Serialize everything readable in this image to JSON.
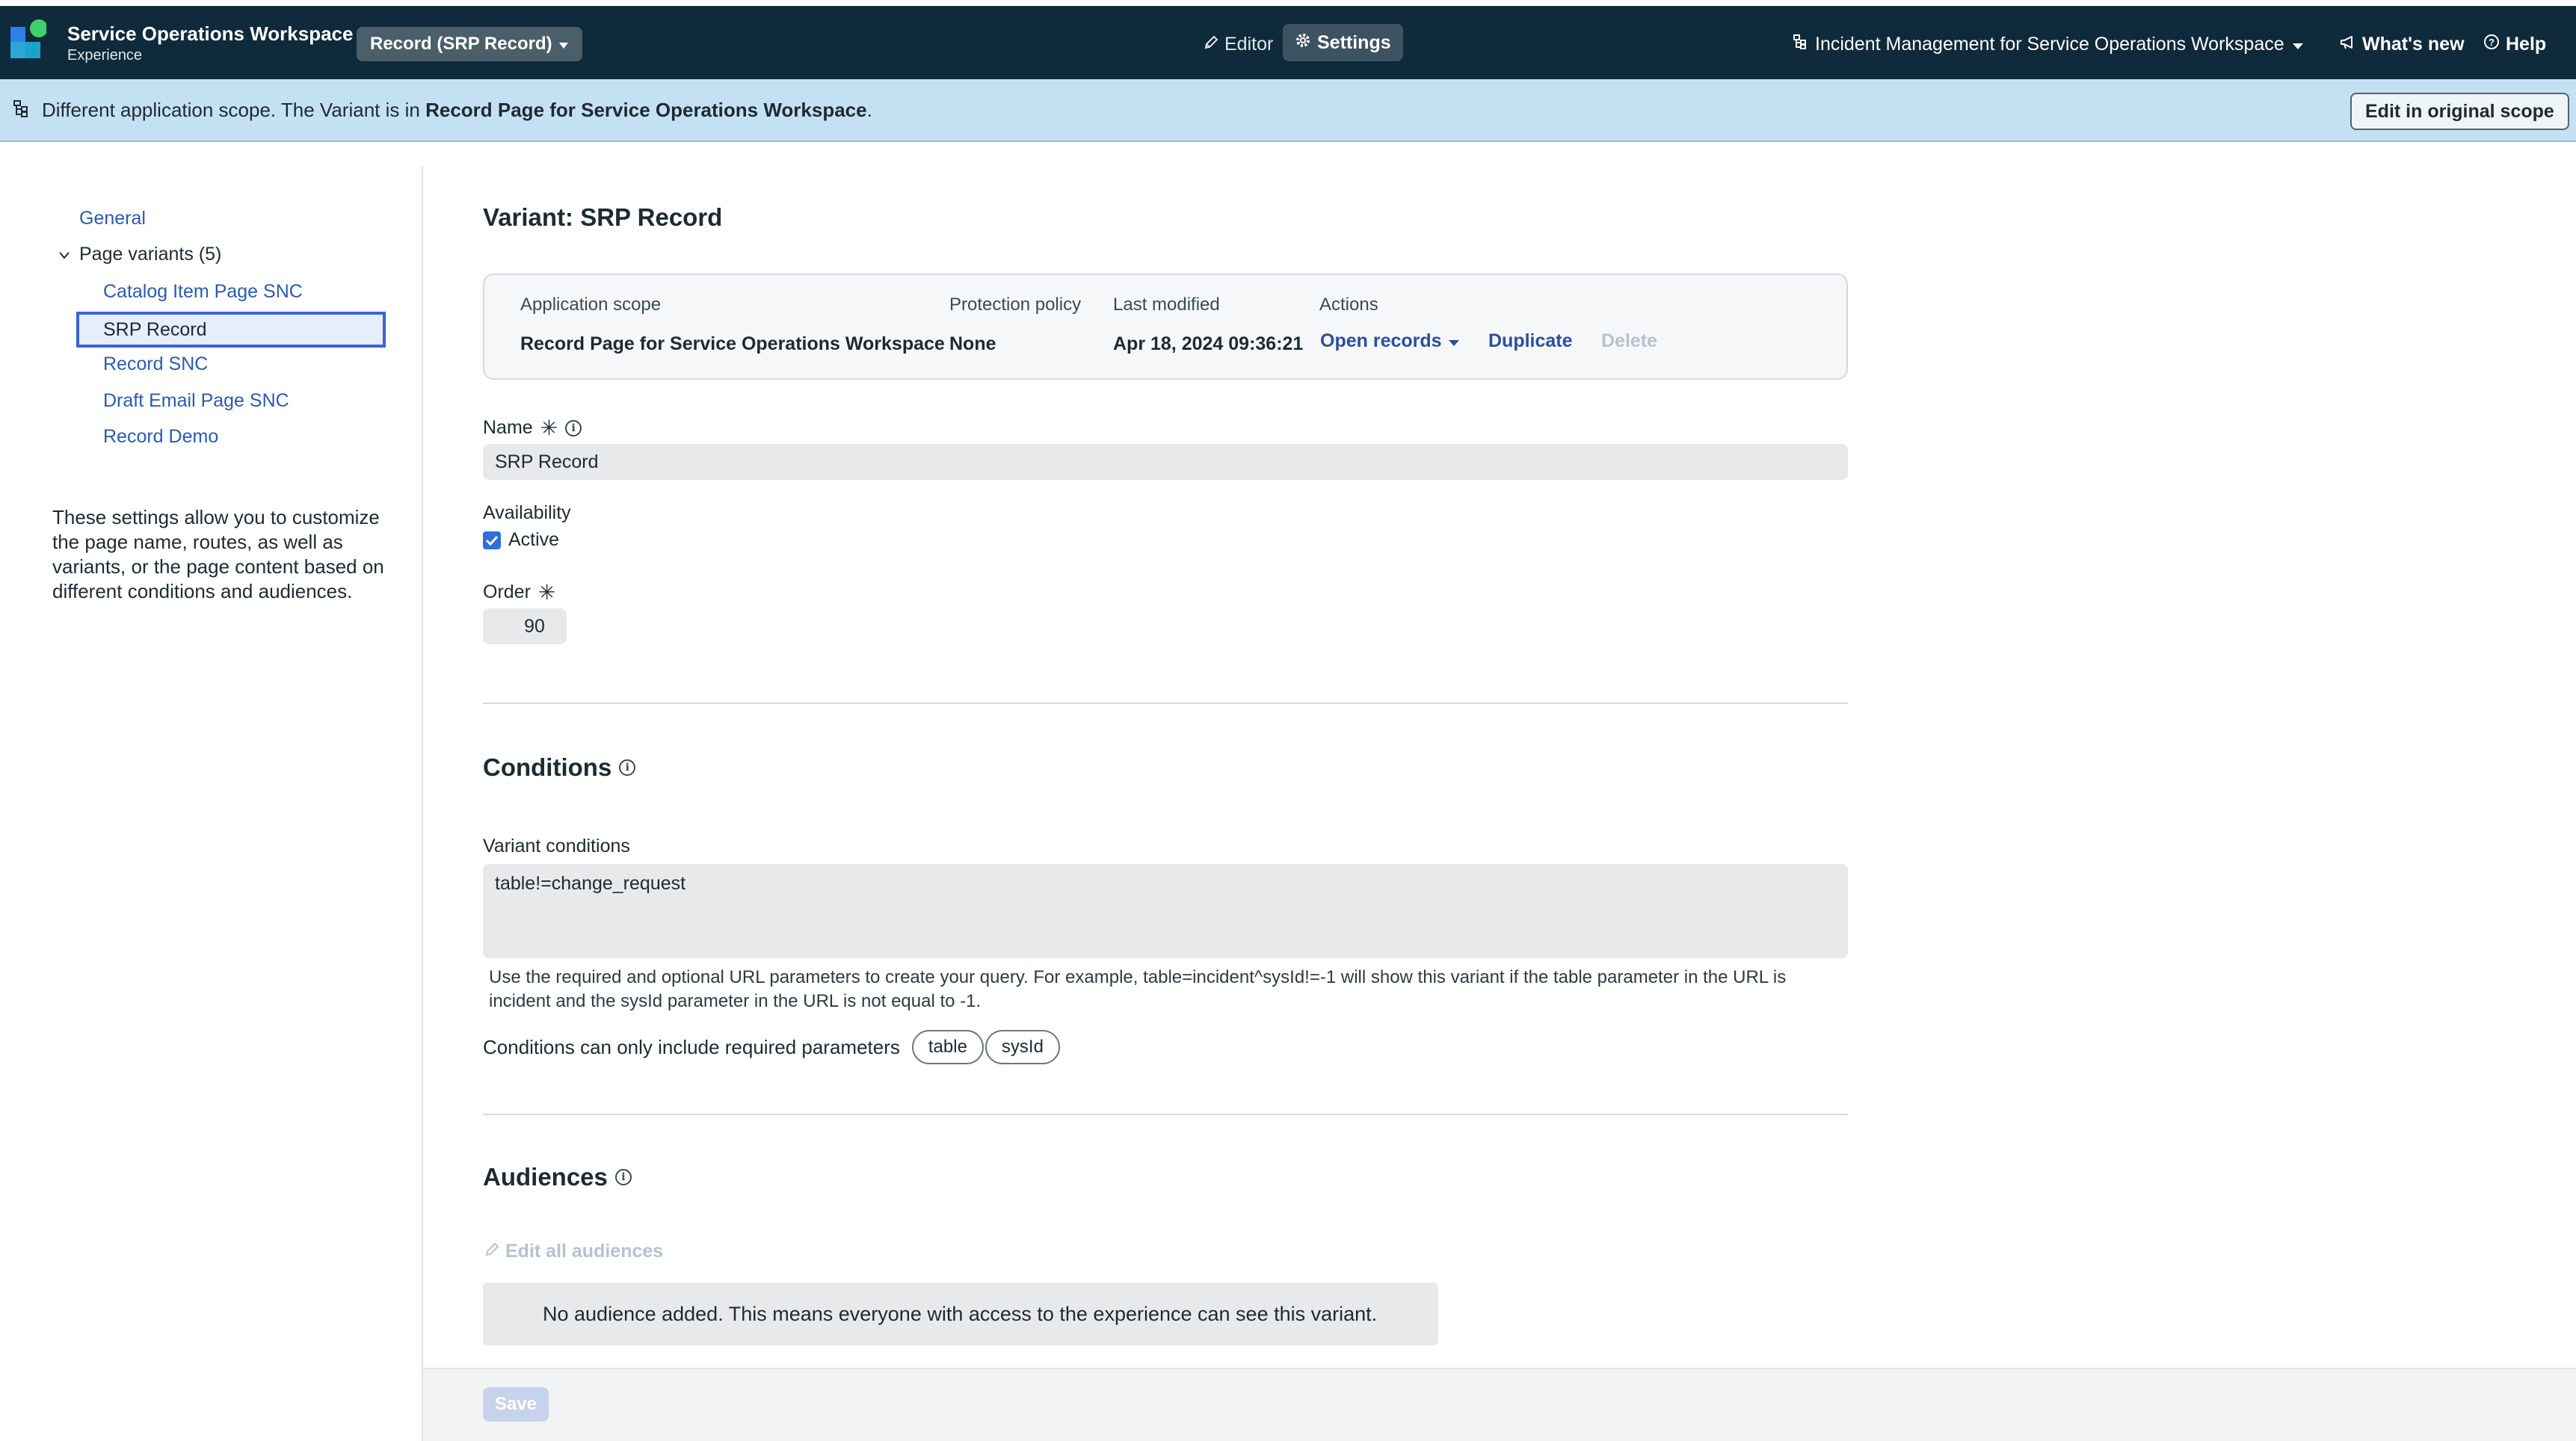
{
  "header": {
    "app_title": "Service Operations Workspace",
    "app_subtitle": "Experience",
    "page_select": "Record (SRP Record)",
    "tabs": {
      "editor": "Editor",
      "settings": "Settings"
    },
    "scope": "Incident Management for Service Operations Workspace",
    "whats_new": "What's new",
    "help": "Help"
  },
  "banner": {
    "text_prefix": "Different application scope. The Variant is in ",
    "scope_name": "Record Page for Service Operations Workspace",
    "text_suffix": ".",
    "button": "Edit in original scope"
  },
  "nav": {
    "general": "General",
    "variants_header": "Page variants (5)",
    "items": [
      {
        "label": "Catalog Item Page SNC"
      },
      {
        "label": "SRP Record",
        "selected": true
      },
      {
        "label": "Record SNC"
      },
      {
        "label": "Draft Email Page SNC"
      },
      {
        "label": "Record Demo"
      }
    ],
    "help_text": "These settings allow you to customize the page name, routes, as well as variants, or the page content based on different conditions and audiences."
  },
  "variant": {
    "title": "Variant: SRP Record",
    "card": {
      "scope_header": "Application scope",
      "scope_value": "Record Page for Service Operations Workspace",
      "policy_header": "Protection policy",
      "policy_value": "None",
      "modified_header": "Last modified",
      "modified_value": "Apr 18, 2024 09:36:21",
      "actions_header": "Actions",
      "open_records": "Open records",
      "duplicate": "Duplicate",
      "delete": "Delete"
    },
    "name_label": "Name",
    "name_value": "SRP Record",
    "availability_label": "Availability",
    "active_label": "Active",
    "active_checked": true,
    "order_label": "Order",
    "order_value": "90"
  },
  "conditions": {
    "title": "Conditions",
    "variant_conditions_label": "Variant conditions",
    "variant_conditions_value": "table!=change_request",
    "help": "Use the required and optional URL parameters to create your query. For example, table=incident^sysId!=-1 will show this variant if the table parameter in the URL is incident and the sysId parameter in the URL is not equal to -1.",
    "required_text": "Conditions can only include required parameters",
    "params": [
      "table",
      "sysId"
    ]
  },
  "audiences": {
    "title": "Audiences",
    "edit_all": "Edit all audiences",
    "empty_message": "No audience added. This means everyone with access to the experience can see this variant."
  },
  "footer": {
    "save": "Save"
  },
  "colors": {
    "topbar": "#0f2a3a",
    "banner": "#c4e1f4",
    "link": "#2c5ab0",
    "selected_border": "#3b62d9",
    "checkbox": "#2f6fda",
    "disabled": "#b6c2d2"
  },
  "icons": [
    "app-logo-icon",
    "caret-down-icon",
    "pencil-icon",
    "gear-icon",
    "scope-tree-icon",
    "megaphone-icon",
    "help-circle-icon",
    "chevron-down-icon",
    "required-star-icon",
    "info-icon",
    "checkmark-icon"
  ]
}
